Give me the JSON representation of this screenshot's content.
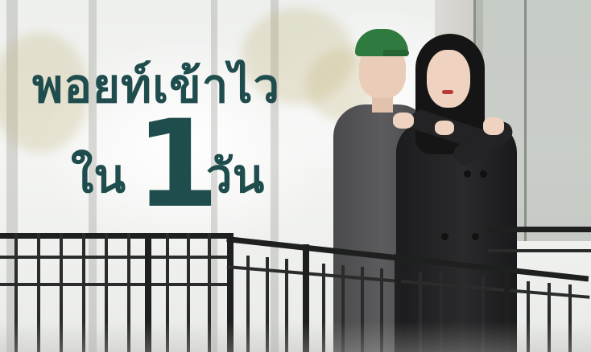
{
  "headline": {
    "line1": "พอยท์เข้าไว",
    "line2_left": "ใน",
    "number": "1",
    "line2_right": "วัน"
  },
  "colors": {
    "headline_text": "#1f4c4c",
    "cap": "#2f7a3e",
    "background": "#eef0ee",
    "railing": "#1e1f1f"
  }
}
